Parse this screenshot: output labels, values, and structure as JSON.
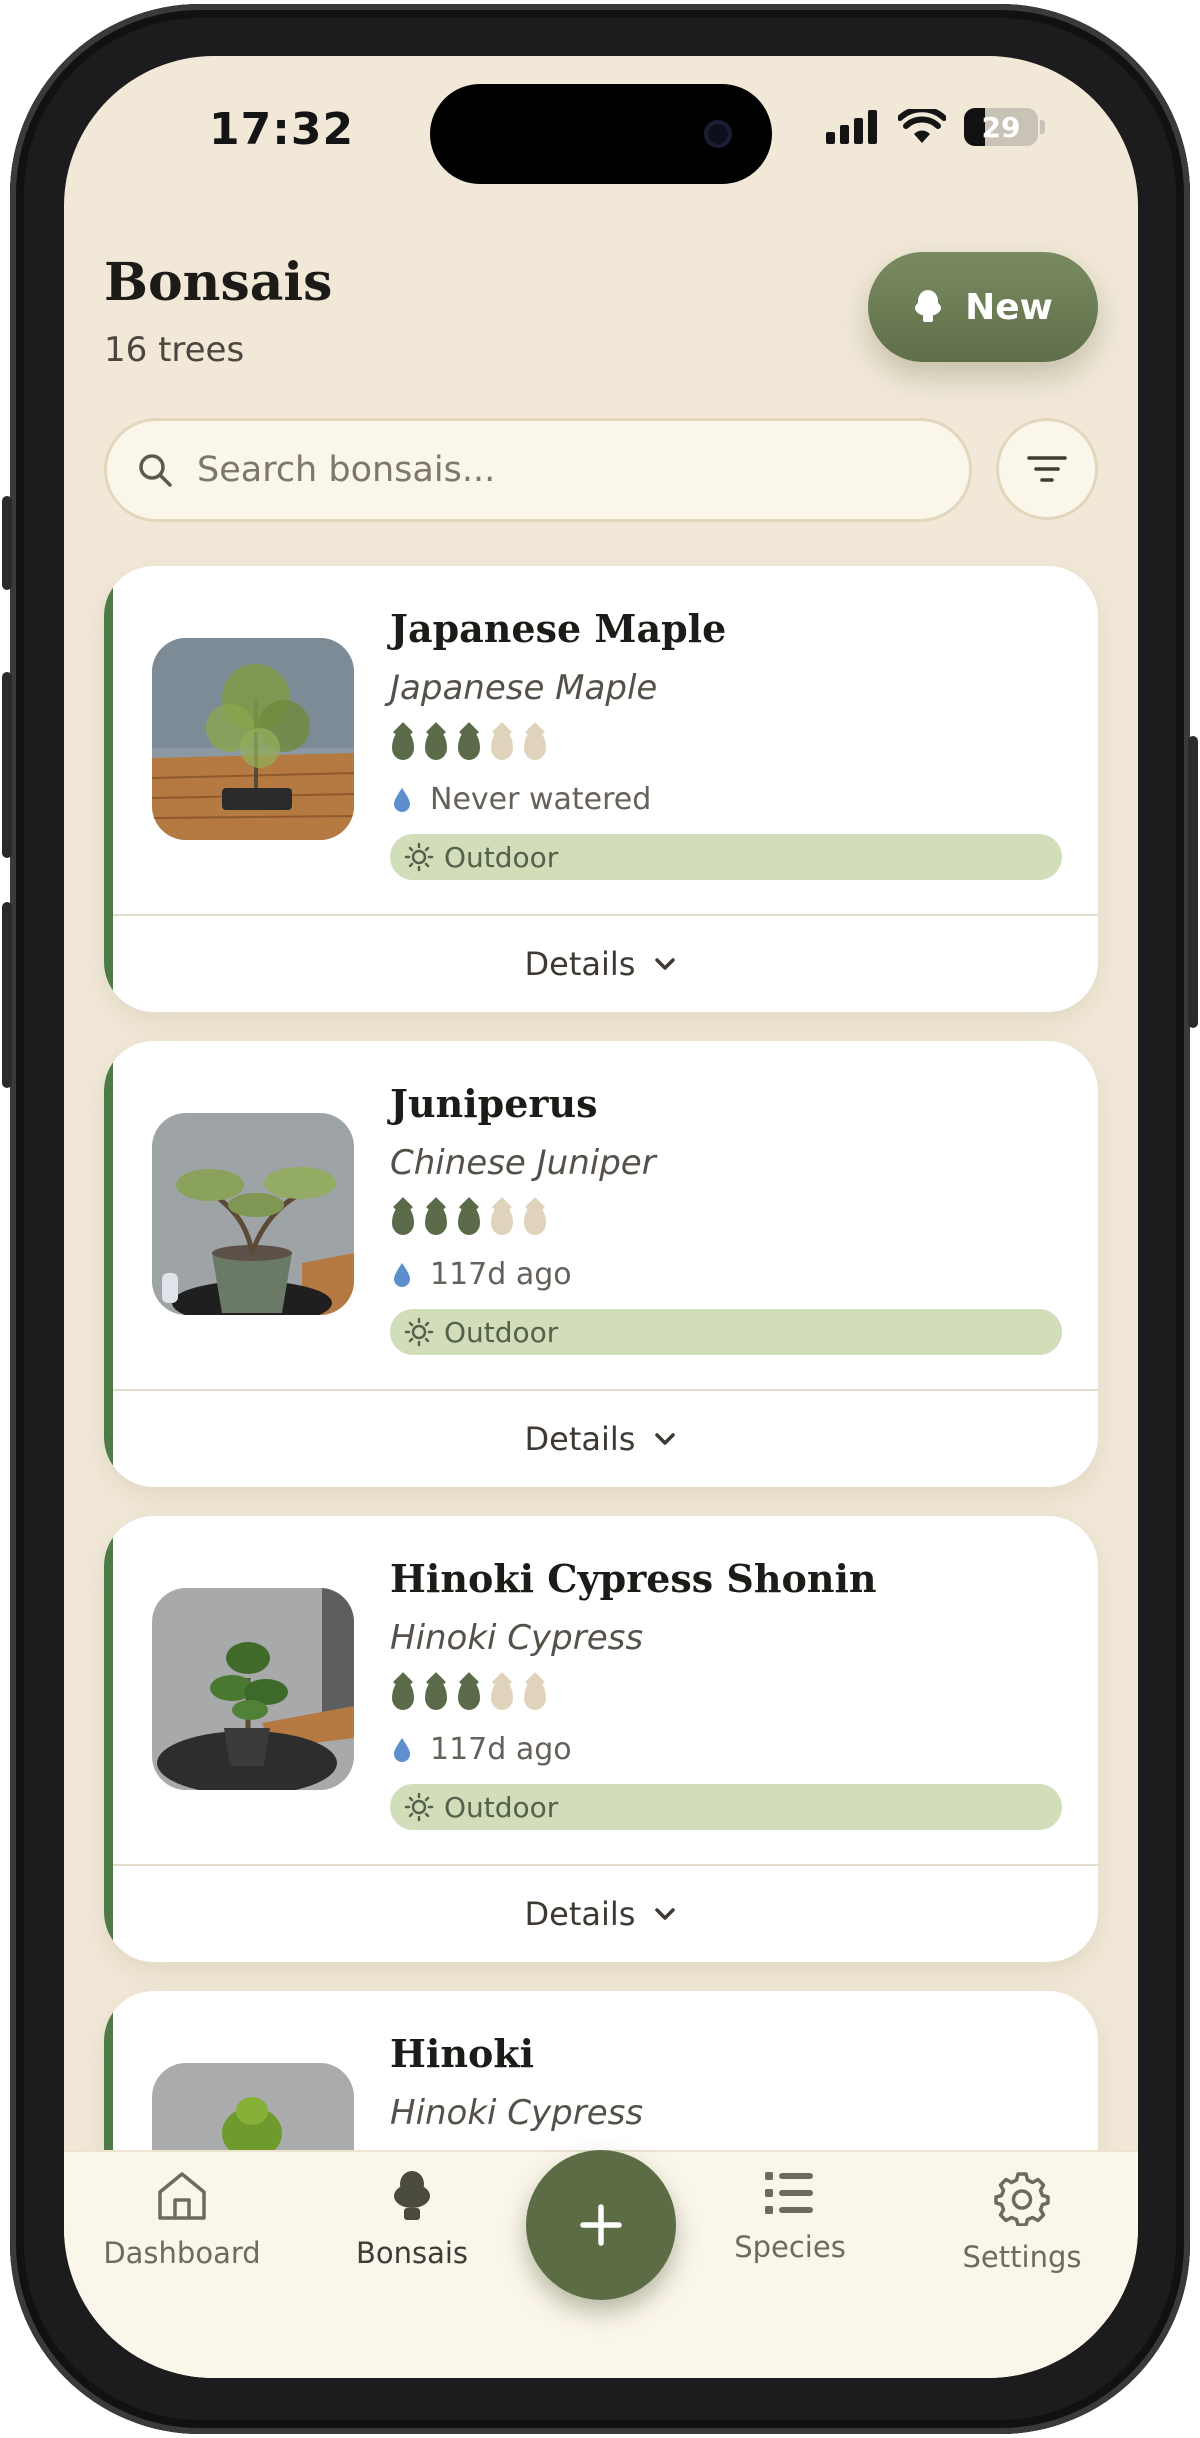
{
  "status_bar": {
    "time": "17:32",
    "battery": "29"
  },
  "header": {
    "title": "Bonsais",
    "subtitle": "16 trees",
    "new_button_label": "New"
  },
  "search": {
    "placeholder": "Search bonsais..."
  },
  "cards": [
    {
      "name": "Japanese Maple",
      "species": "Japanese Maple",
      "water_need": 3,
      "water_max": 5,
      "last_watered": "Never watered",
      "location": "Outdoor",
      "details_label": "Details"
    },
    {
      "name": "Juniperus",
      "species": "Chinese Juniper",
      "water_need": 3,
      "water_max": 5,
      "last_watered": "117d ago",
      "location": "Outdoor",
      "details_label": "Details"
    },
    {
      "name": "Hinoki Cypress Shonin",
      "species": "Hinoki Cypress",
      "water_need": 3,
      "water_max": 5,
      "last_watered": "117d ago",
      "location": "Outdoor",
      "details_label": "Details"
    },
    {
      "name": "Hinoki",
      "species": "Hinoki Cypress"
    }
  ],
  "bottom_nav": {
    "items": [
      {
        "label": "Dashboard",
        "icon": "home-icon"
      },
      {
        "label": "Bonsais",
        "icon": "bonsai-tree-icon",
        "active": true
      },
      {
        "label": "Species",
        "icon": "list-icon"
      },
      {
        "label": "Settings",
        "icon": "gear-icon"
      }
    ],
    "fab_icon": "plus-icon"
  },
  "colors": {
    "background": "#f1e8d8",
    "accent": "#5c6d45",
    "card_stripe": "#4d7a45",
    "badge": "#d2deb9",
    "water_drop": "#5b6a48"
  }
}
